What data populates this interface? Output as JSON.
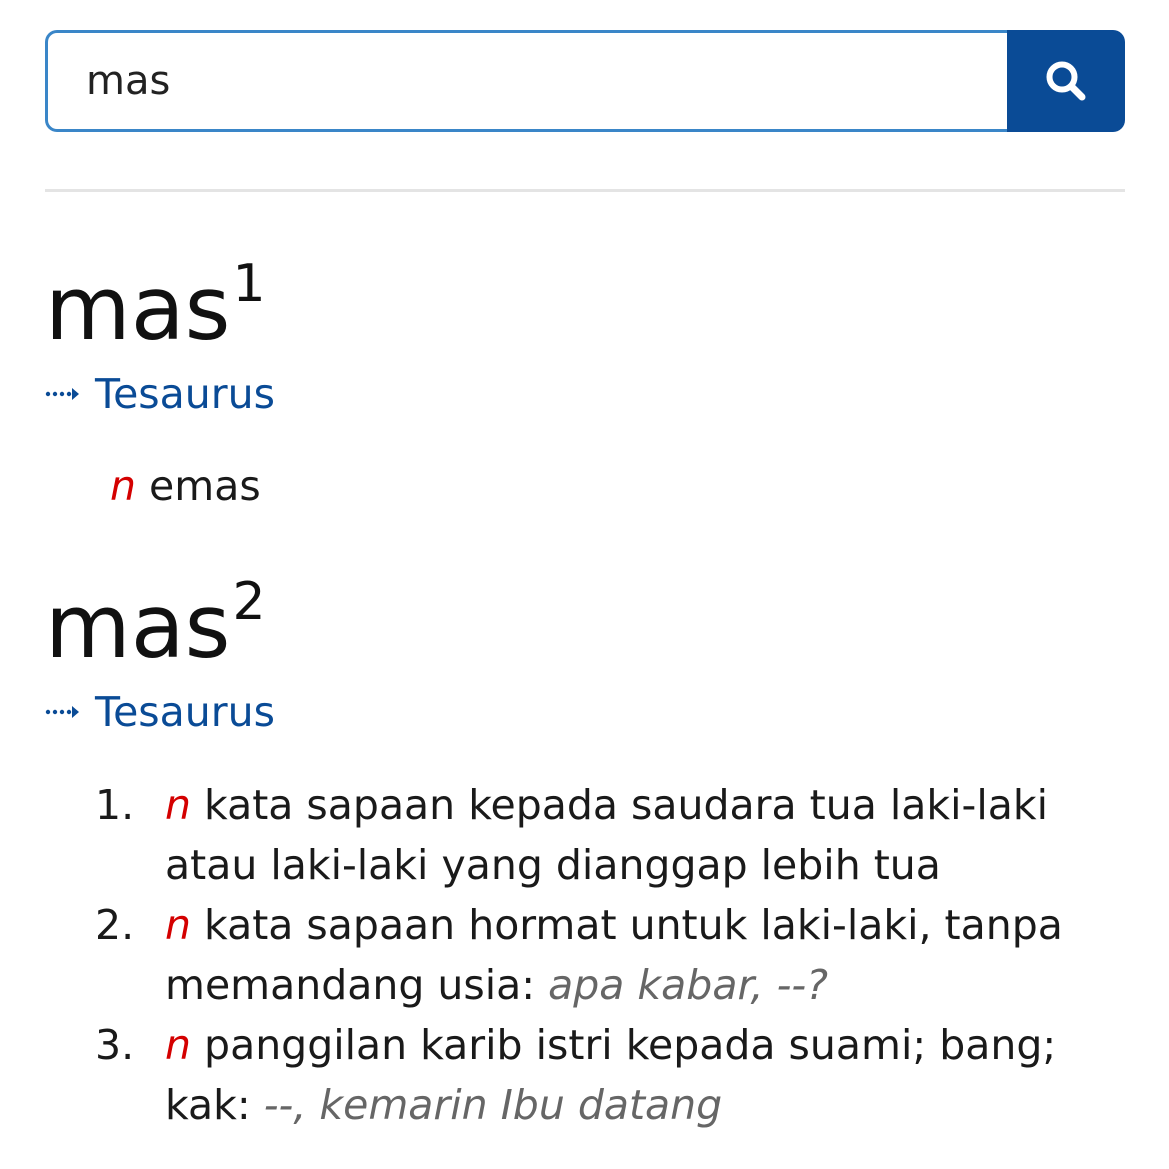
{
  "search": {
    "value": "mas",
    "button_icon": "search-icon"
  },
  "colors": {
    "accent": "#0a4b96",
    "input_border": "#3a86c8",
    "pos": "#d40000",
    "example": "#666666"
  },
  "entries": [
    {
      "word": "mas",
      "homonym": "1",
      "thesaurus_label": "Tesaurus",
      "senses": [
        {
          "pos": "n",
          "definition": "emas"
        }
      ]
    },
    {
      "word": "mas",
      "homonym": "2",
      "thesaurus_label": "Tesaurus",
      "senses": [
        {
          "number": "1.",
          "pos": "n",
          "definition": "kata sapaan kepada saudara tua laki-laki atau laki-laki yang dianggap lebih tua"
        },
        {
          "number": "2.",
          "pos": "n",
          "definition": "kata sapaan hormat untuk laki-laki, tanpa memandang usia: ",
          "example": "apa kabar, --?"
        },
        {
          "number": "3.",
          "pos": "n",
          "definition": "panggilan karib istri kepada suami; bang; kak: ",
          "example": "--, kemarin Ibu datang"
        }
      ]
    }
  ]
}
